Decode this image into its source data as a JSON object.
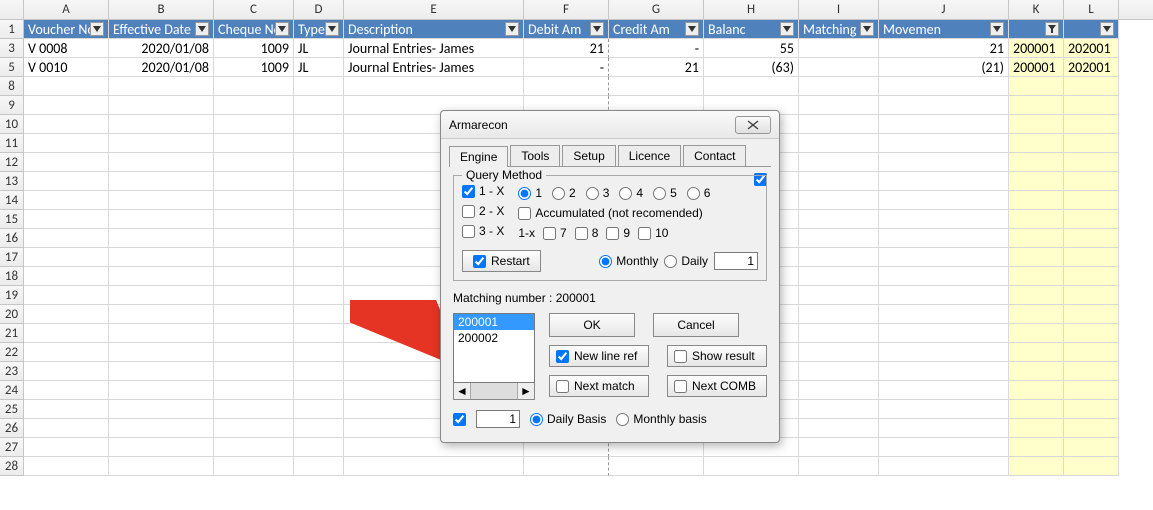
{
  "columns": {
    "labels": [
      "A",
      "B",
      "C",
      "D",
      "E",
      "F",
      "G",
      "H",
      "I",
      "J",
      "K",
      "L"
    ],
    "widths": [
      85,
      105,
      80,
      50,
      180,
      85,
      95,
      95,
      80,
      130,
      55,
      55
    ]
  },
  "headers": [
    "Voucher No",
    "Effective Date",
    "Cheque No",
    "Type",
    "Description",
    "Debit Am",
    "Credit Am",
    "Balanc",
    "Matching",
    "Movemen",
    "",
    ""
  ],
  "visible_rows": [
    "3",
    "5",
    "8",
    "9",
    "10",
    "11",
    "12",
    "13",
    "14",
    "15",
    "16",
    "17",
    "18",
    "19",
    "20",
    "21",
    "22",
    "23",
    "24",
    "25",
    "26",
    "27",
    "28"
  ],
  "data": {
    "3": [
      "V 0008",
      "2020/01/08",
      "1009",
      "JL",
      "Journal Entries- James",
      "21",
      "-",
      "55",
      "",
      "21",
      "200001",
      "202001"
    ],
    "5": [
      "V 0010",
      "2020/01/08",
      "1009",
      "JL",
      "Journal Entries- James",
      "-",
      "21",
      "(63)",
      "",
      "(21)",
      "200001",
      "202001"
    ]
  },
  "dialog_title": "Armarecon",
  "tabs": [
    "Engine",
    "Tools",
    "Setup",
    "Licence",
    "Contact"
  ],
  "active_tab": "Engine",
  "query_method_label": "Query Method",
  "qm_checks": [
    {
      "label": "1 - X",
      "checked": true
    },
    {
      "label": "2 - X",
      "checked": false
    },
    {
      "label": "3 - X",
      "checked": false
    }
  ],
  "num_radios": [
    "1",
    "2",
    "3",
    "4",
    "5",
    "6"
  ],
  "num_radio_selected": "1",
  "accumulated_label": "Accumulated (not recomended)",
  "onex_label": "1-x",
  "onex_checks": [
    "7",
    "8",
    "9",
    "10"
  ],
  "restart_label": "Restart",
  "period_monthly": "Monthly",
  "period_daily": "Daily",
  "period_value": "1",
  "matching_label": "Matching number : 200001",
  "list": [
    "200001",
    "200002"
  ],
  "list_selected": "200001",
  "ok": "OK",
  "cancel": "Cancel",
  "new_line_ref": "New line ref",
  "show_result": "Show result",
  "next_match": "Next match",
  "next_comb": "Next COMB",
  "bottom_value": "1",
  "daily_basis": "Daily Basis",
  "monthly_basis": "Monthly basis"
}
